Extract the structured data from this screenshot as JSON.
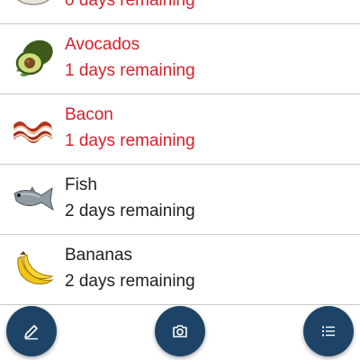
{
  "items": [
    {
      "name": "",
      "remaining": "0 days remaining",
      "urgent": true,
      "icon": "dish-icon"
    },
    {
      "name": "Avocados",
      "remaining": "1 days remaining",
      "urgent": true,
      "icon": "avocado-icon"
    },
    {
      "name": "Bacon",
      "remaining": "1 days remaining",
      "urgent": true,
      "icon": "bacon-icon"
    },
    {
      "name": "Fish",
      "remaining": "2 days remaining",
      "urgent": false,
      "icon": "fish-icon"
    },
    {
      "name": "Bananas",
      "remaining": "2 days remaining",
      "urgent": false,
      "icon": "banana-icon"
    }
  ],
  "actions": {
    "edit": "pencil-icon",
    "camera": "camera-icon",
    "list": "list-icon"
  },
  "colors": {
    "urgent": "#d8202a",
    "normal": "#1f1f1f",
    "fab": "#1d4466",
    "divider": "#c8c8c8"
  }
}
